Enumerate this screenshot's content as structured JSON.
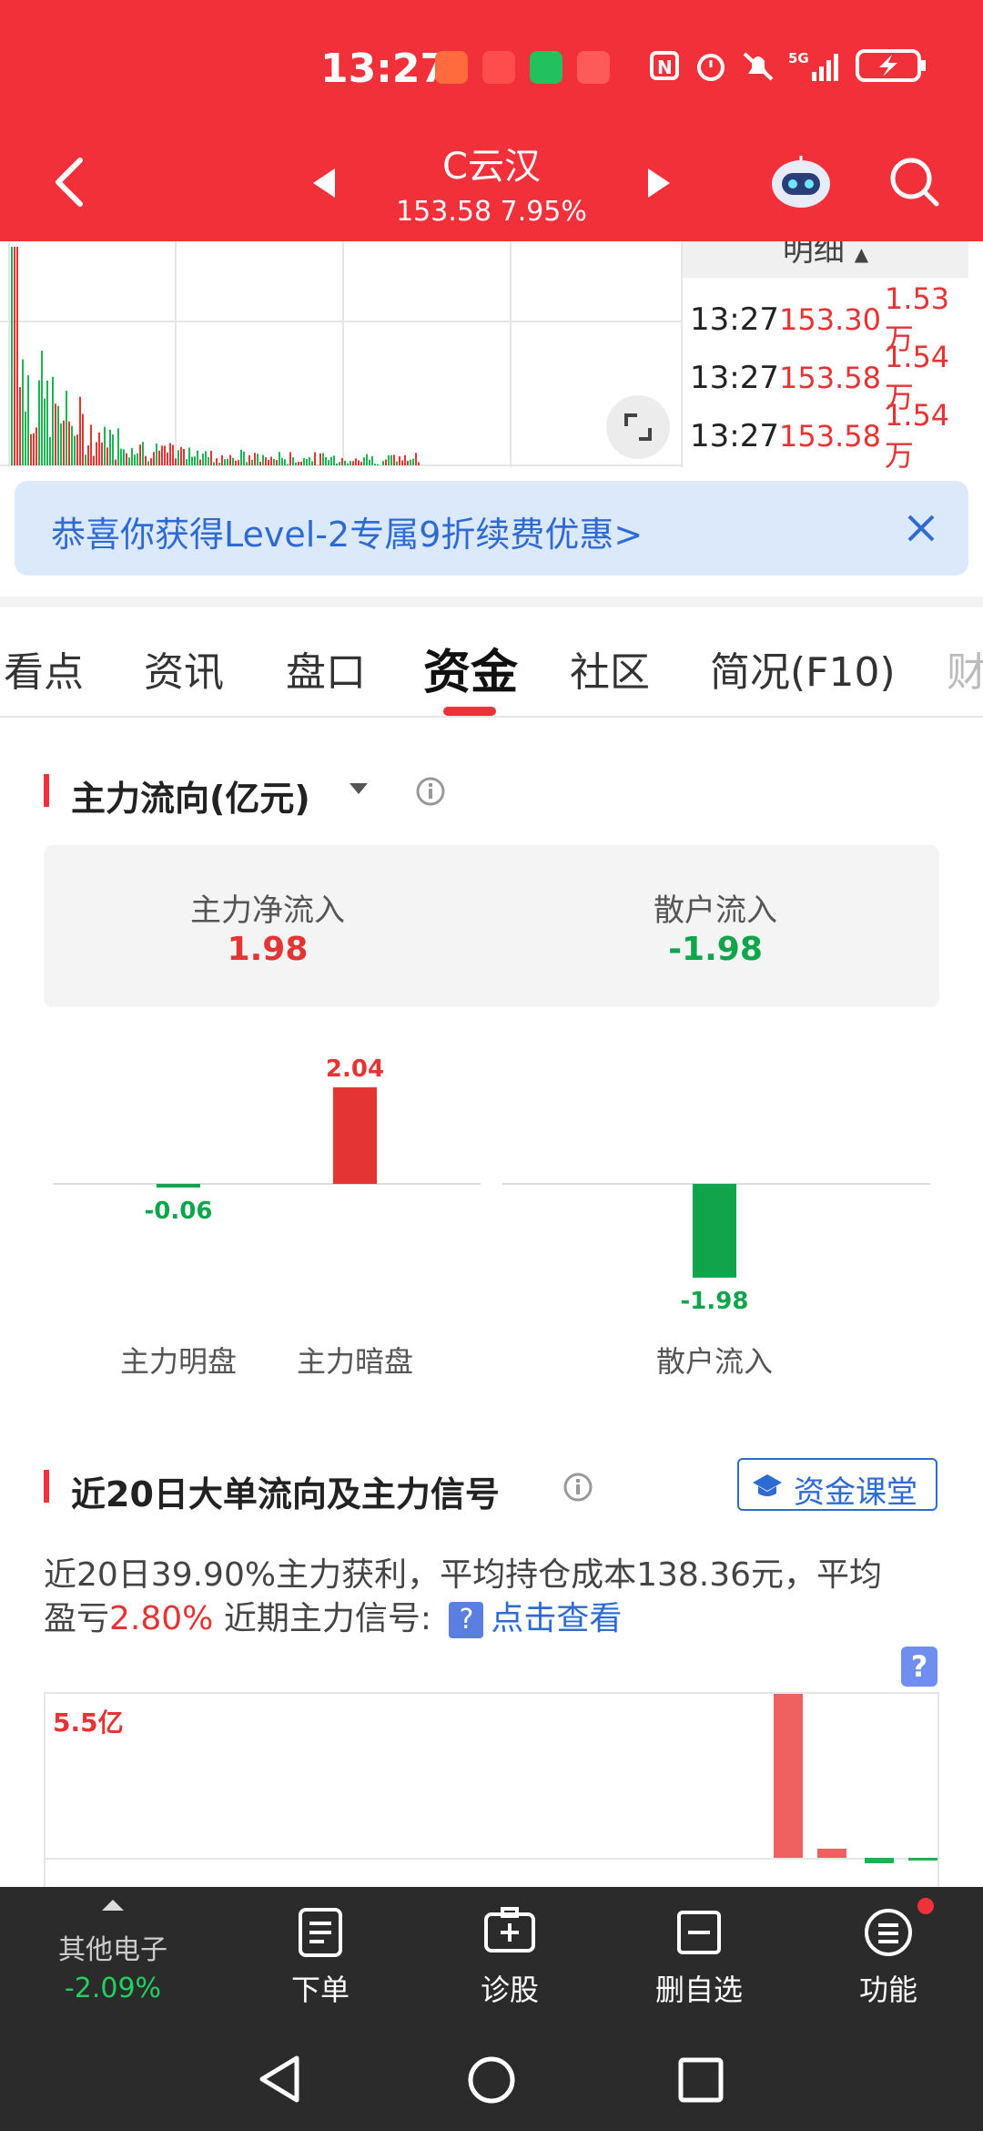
{
  "status_bar": {
    "time": "13:27"
  },
  "header": {
    "stock_name": "C云汉",
    "stock_price": "153.58 7.95%"
  },
  "detail": {
    "title": "明细",
    "rows": [
      {
        "time": "13:27",
        "price": "153.30",
        "vol": "1.53万"
      },
      {
        "time": "13:27",
        "price": "153.58",
        "vol": "1.54万"
      },
      {
        "time": "13:27",
        "price": "153.58",
        "vol": "1.54万"
      }
    ]
  },
  "banner": {
    "text": "恭喜你获得Level-2专属9折续费优惠>"
  },
  "tabs": [
    "看点",
    "资讯",
    "盘口",
    "资金",
    "社区",
    "简况(F10)",
    "财"
  ],
  "main_flow": {
    "title": "主力流向(亿元)",
    "net_label": "主力净流入",
    "net_value": "1.98",
    "retail_label": "散户流入",
    "retail_value": "-1.98"
  },
  "chart_data": [
    {
      "type": "bar",
      "categories": [
        "主力明盘",
        "主力暗盘",
        "散户流入"
      ],
      "values": [
        -0.06,
        2.04,
        -1.98
      ],
      "data_labels": [
        "-0.06",
        "2.04",
        "-1.98"
      ]
    },
    {
      "type": "bar",
      "title": "近20日大单流向及主力信号",
      "ylabel_top": "5.5亿"
    }
  ],
  "big_order": {
    "title": "近20日大单流向及主力信号",
    "class_button": "资金课堂",
    "desc_line1": "近20日39.90%主力获利，平均持仓成本138.36元，平均",
    "desc_line2_a": "盈亏",
    "desc_line2_pct": "2.80%",
    "desc_line2_b": " 近期主力信号:",
    "link": "点击查看",
    "y_top_label": "5.5亿"
  },
  "bottom_bar": {
    "sector_name": "其他电子",
    "sector_change": "-2.09%",
    "items": [
      "下单",
      "诊股",
      "删自选",
      "功能"
    ]
  },
  "colors": {
    "brand": "#f2303a",
    "up": "#e53434",
    "down": "#10a54a",
    "link": "#2d6bd3"
  }
}
